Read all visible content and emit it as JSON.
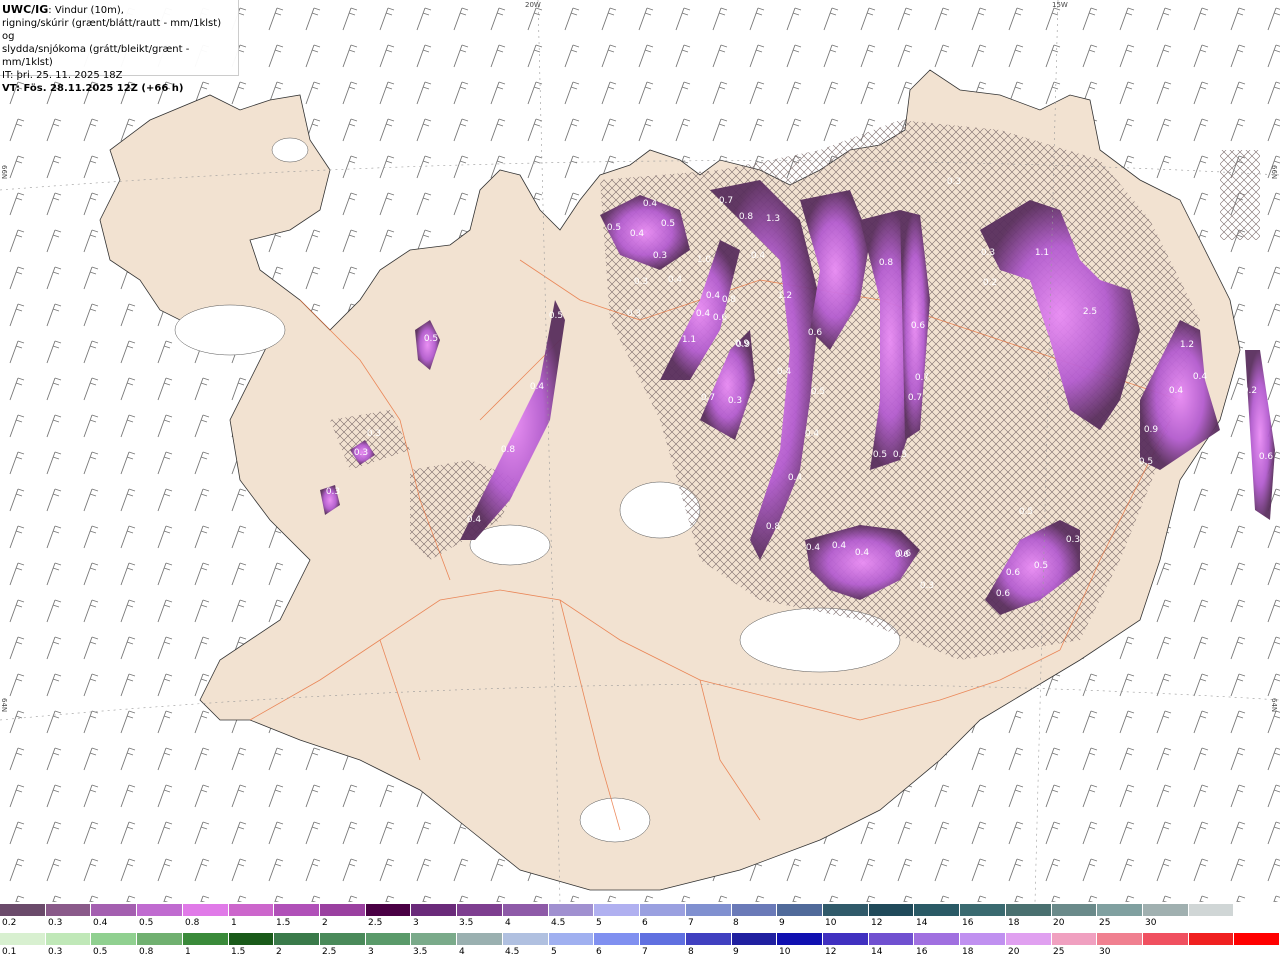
{
  "info": {
    "brand": "UWC/IG",
    "line1_rest": ": Vindur (10m),",
    "line2": "rigning/skúrir (grænt/blátt/rautt - mm/1klst) og",
    "line3": "slydda/snjókoma (grátt/bleikt/grænt - mm/1klst)",
    "line4": "IT: þri. 25. 11. 2025 18Z",
    "line5": "VT: Fös. 28.11.2025 12Z (+66 h)"
  },
  "lonlat": {
    "top_20w": "20W",
    "top_15w": "15W",
    "left_66n": "66N",
    "right_66n": "66N",
    "left_64n": "64N",
    "right_64n": "64N"
  },
  "colors": {
    "land": "#f2e2d1",
    "sea": "#ffffff",
    "roads": "#e8703a",
    "precip_light": "#a35bd0",
    "precip_mid": "#d973f0",
    "precip_dark": "#5a2f5e",
    "hatch": "#7a6a6a"
  },
  "precip_labels": [
    "0.4",
    "0.5",
    "0.4",
    "0.5",
    "0.3",
    "0.3",
    "0.4",
    "1.0",
    "0.4",
    "0.4",
    "0.6",
    "1.1",
    "0.8",
    "0.3",
    "0.9",
    "0.7",
    "0.8",
    "1.3",
    "0.4",
    "1.2",
    "0.8",
    "0.6",
    "0.6",
    "0.5",
    "0.4",
    "0.4",
    "0.7",
    "0.7",
    "0.5",
    "0.5",
    "0.4",
    "0.8",
    "0.3",
    "0.9",
    "1.1",
    "0.3",
    "0.2",
    "2.5",
    "1.2",
    "0.4",
    "0.4",
    "0.9",
    "0.5",
    "0.5",
    "0.6",
    "0.5",
    "0.3",
    "0.6",
    "0.7",
    "0.6",
    "0.3",
    "0.4",
    "0.4",
    "0.4",
    "0.6",
    "0.3",
    "0.5",
    "0.4",
    "0.8",
    "0.4",
    "0.3",
    "0.3",
    "0.3",
    "0.5",
    "0.6",
    "0.2"
  ],
  "legend_snow": {
    "colors": [
      "#6b4b6b",
      "#8a5a8a",
      "#a45fb0",
      "#c06bd0",
      "#e07ae8",
      "#cc66cc",
      "#b050b8",
      "#9a40a0",
      "#4a0044",
      "#6a2a7a",
      "#7e3e90",
      "#8e5aa8",
      "#a090d0",
      "#b0b0f0",
      "#9aa0e0",
      "#8090d0",
      "#6a7ab8",
      "#506a9a",
      "#305a6a",
      "#204a5a",
      "#2a5a66",
      "#3a6a70",
      "#4a7070",
      "#6a8a8a",
      "#80a0a0",
      "#a0b0b0",
      "#d0d6d6",
      "#ffffff"
    ],
    "labels": [
      "0.2",
      "0.3",
      "0.4",
      "0.5",
      "0.8",
      "1",
      "1.5",
      "2",
      "2.5",
      "3",
      "3.5",
      "4",
      "4.5",
      "5",
      "6",
      "7",
      "8",
      "9",
      "10",
      "12",
      "14",
      "16",
      "18",
      "20",
      "25",
      "30"
    ]
  },
  "legend_rain": {
    "colors": [
      "#d8f0d0",
      "#c0e8b8",
      "#90d090",
      "#70b070",
      "#3a8a3a",
      "#1a5a1a",
      "#3a7a4a",
      "#4a8a5a",
      "#5a9a6a",
      "#7aaa8a",
      "#9ab0b0",
      "#b0c0e0",
      "#a0b0f0",
      "#8090f0",
      "#6070e0",
      "#4040c0",
      "#2020a0",
      "#1010b0",
      "#4030c0",
      "#7050d0",
      "#a070e0",
      "#c090f0",
      "#e0a0f0",
      "#f0a0c0",
      "#f08090",
      "#f05060",
      "#f02020",
      "#ff0000"
    ],
    "labels": [
      "0.1",
      "0.3",
      "0.5",
      "0.8",
      "1",
      "1.5",
      "2",
      "2.5",
      "3",
      "3.5",
      "4",
      "4.5",
      "5",
      "6",
      "7",
      "8",
      "9",
      "10",
      "12",
      "14",
      "16",
      "18",
      "20",
      "25",
      "30"
    ]
  }
}
